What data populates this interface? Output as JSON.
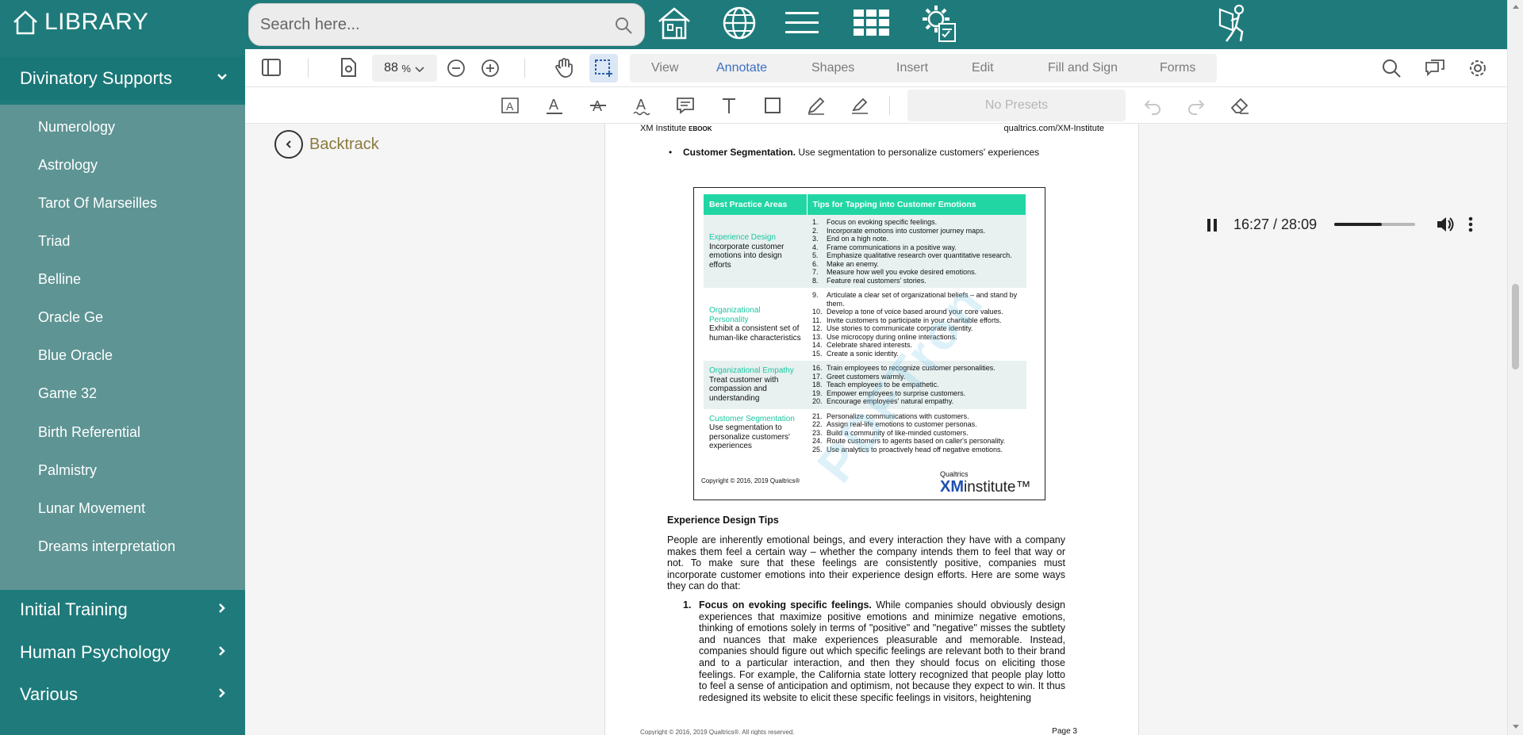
{
  "app": {
    "logo_text": "LIBRARY",
    "search_placeholder": "Search here..."
  },
  "top_icons": [
    "house-icon",
    "globe-icon",
    "hamburger-menu-icon",
    "grid-icon",
    "settings-checklist-icon",
    "user-reading-icon"
  ],
  "sidebar": {
    "sections": [
      {
        "label": "Divinatory Supports",
        "expanded": true
      },
      {
        "label": "Initial Training",
        "expanded": false
      },
      {
        "label": "Human Psychology",
        "expanded": false
      },
      {
        "label": "Various",
        "expanded": false
      }
    ],
    "items": [
      {
        "label": "Numerology"
      },
      {
        "label": "Astrology"
      },
      {
        "label": "Tarot Of Marseilles"
      },
      {
        "label": "Triad"
      },
      {
        "label": "Belline"
      },
      {
        "label": "Oracle Ge"
      },
      {
        "label": "Blue Oracle"
      },
      {
        "label": "Game 32"
      },
      {
        "label": "Birth Referential"
      },
      {
        "label": "Palmistry"
      },
      {
        "label": "Lunar Movement"
      },
      {
        "label": "Dreams interpretation"
      }
    ]
  },
  "viewer": {
    "zoom": "88",
    "zoom_unit": "%",
    "tabs": [
      {
        "label": "View"
      },
      {
        "label": "Annotate",
        "active": true
      },
      {
        "label": "Shapes"
      },
      {
        "label": "Insert"
      },
      {
        "label": "Edit"
      },
      {
        "label": "Fill and Sign"
      },
      {
        "label": "Forms"
      }
    ],
    "presets_label": "No Presets",
    "backtrack_label": "Backtrack"
  },
  "player": {
    "time": "16:27 / 28:09",
    "progress": 0.585,
    "volume": 0.6
  },
  "document": {
    "header_left": "XM Institute",
    "header_left_small": "EBOOK",
    "header_right": "qualtrics.com/XM-Institute",
    "bullet_title": "Customer Segmentation.",
    "bullet_text": " Use segmentation to personalize customers' experiences",
    "table": {
      "col1": "Best Practice Areas",
      "col2": "Tips for Tapping into Customer Emotions",
      "rows": [
        {
          "title": "Experience Design",
          "desc": "Incorporate customer emotions into design efforts",
          "tips": [
            {
              "n": "1.",
              "t": "Focus on evoking specific feelings."
            },
            {
              "n": "2.",
              "t": "Incorporate emotions into customer journey maps."
            },
            {
              "n": "3.",
              "t": "End on a high note."
            },
            {
              "n": "4.",
              "t": "Frame communications in a positive way."
            },
            {
              "n": "5.",
              "t": "Emphasize qualitative research over quantitative research."
            },
            {
              "n": "6.",
              "t": "Make an enemy."
            },
            {
              "n": "7.",
              "t": "Measure how well you evoke desired emotions."
            },
            {
              "n": "8.",
              "t": "Feature real customers' stories."
            }
          ]
        },
        {
          "title": "Organizational Personality",
          "desc": "Exhibit a consistent set of human-like characteristics",
          "tips": [
            {
              "n": "9.",
              "t": "Articulate a clear set of organizational beliefs – and stand by them."
            },
            {
              "n": "10.",
              "t": "Develop a tone of voice based around your core values."
            },
            {
              "n": "11.",
              "t": "Invite customers to participate in your charitable efforts."
            },
            {
              "n": "12.",
              "t": "Use stories to communicate corporate identity."
            },
            {
              "n": "13.",
              "t": "Use microcopy during online interactions."
            },
            {
              "n": "14.",
              "t": "Celebrate shared interests."
            },
            {
              "n": "15.",
              "t": "Create a sonic identity."
            }
          ]
        },
        {
          "title": "Organizational Empathy",
          "desc": "Treat customer with compassion and understanding",
          "tips": [
            {
              "n": "16.",
              "t": "Train employees to recognize customer personalities."
            },
            {
              "n": "17.",
              "t": "Greet customers warmly."
            },
            {
              "n": "18.",
              "t": "Teach employees to be empathetic."
            },
            {
              "n": "19.",
              "t": "Empower employees to surprise customers."
            },
            {
              "n": "20.",
              "t": "Encourage employees' natural empathy."
            }
          ]
        },
        {
          "title": "Customer Segmentation",
          "desc": "Use segmentation to personalize customers' experiences",
          "tips": [
            {
              "n": "21.",
              "t": "Personalize communications with customers."
            },
            {
              "n": "22.",
              "t": "Assign real-life emotions to customer personas."
            },
            {
              "n": "23.",
              "t": "Build a community of like-minded customers."
            },
            {
              "n": "24.",
              "t": "Route customers to agents based on caller's personality."
            },
            {
              "n": "25.",
              "t": "Use analytics to proactively head off negative emotions."
            }
          ]
        }
      ],
      "copyright": "Copyright © 2016, 2019 Qualtrics®",
      "brand_top": "Qualtrics",
      "brand_xm": "XM",
      "brand_institute": "institute™"
    },
    "section_title": "Experience Design Tips",
    "paragraph": "People are inherently emotional beings, and every interaction they have with a company makes them feel a certain way – whether the company intends them to feel that way or not. To make sure that these feelings are consistently positive, companies must incorporate customer emotions into their experience design efforts. Here are some ways they can do that:",
    "item1_num": "1.",
    "item1_title": "Focus on evoking specific feelings.",
    "item1_text": " While companies should obviously design experiences that maximize positive emotions and minimize negative emotions, thinking of emotions solely in terms of \"positive\" and \"negative\" misses the subtlety and nuances that make experiences pleasurable and memorable. Instead, companies should figure out which specific feelings are relevant both to their brand and to a particular interaction, and then they should focus on eliciting those feelings. For example, the California state lottery recognized that people play lotto to feel a sense of anticipation and optimism, not because they expect to win. It thus redesigned its website to elicit these specific feelings in visitors, heightening",
    "footer_left": "Copyright © 2016, 2019 Qualtrics®. All rights reserved.",
    "footer_right": "Page 3",
    "watermark": "PDFTron"
  }
}
